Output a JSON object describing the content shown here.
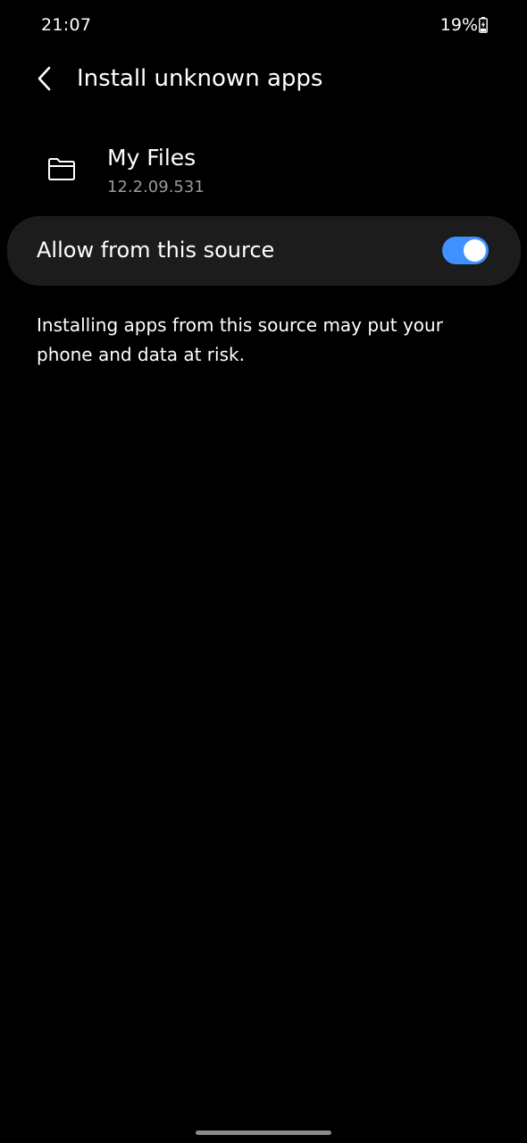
{
  "status_bar": {
    "time": "21:07",
    "battery_percent": "19%",
    "battery_icon": "battery-charging-icon"
  },
  "app_bar": {
    "back_icon": "chevron-left-icon",
    "title": "Install unknown apps"
  },
  "app_info": {
    "icon": "folder-icon",
    "name": "My Files",
    "version": "12.2.09.531"
  },
  "setting": {
    "label": "Allow from this source",
    "enabled": true,
    "switch_color": "#3e91ff"
  },
  "warning": {
    "text": "Installing apps from this source may put your phone and data at risk."
  },
  "colors": {
    "background": "#000000",
    "card": "#1c1c1c",
    "secondary_text": "#9a9a9a"
  }
}
